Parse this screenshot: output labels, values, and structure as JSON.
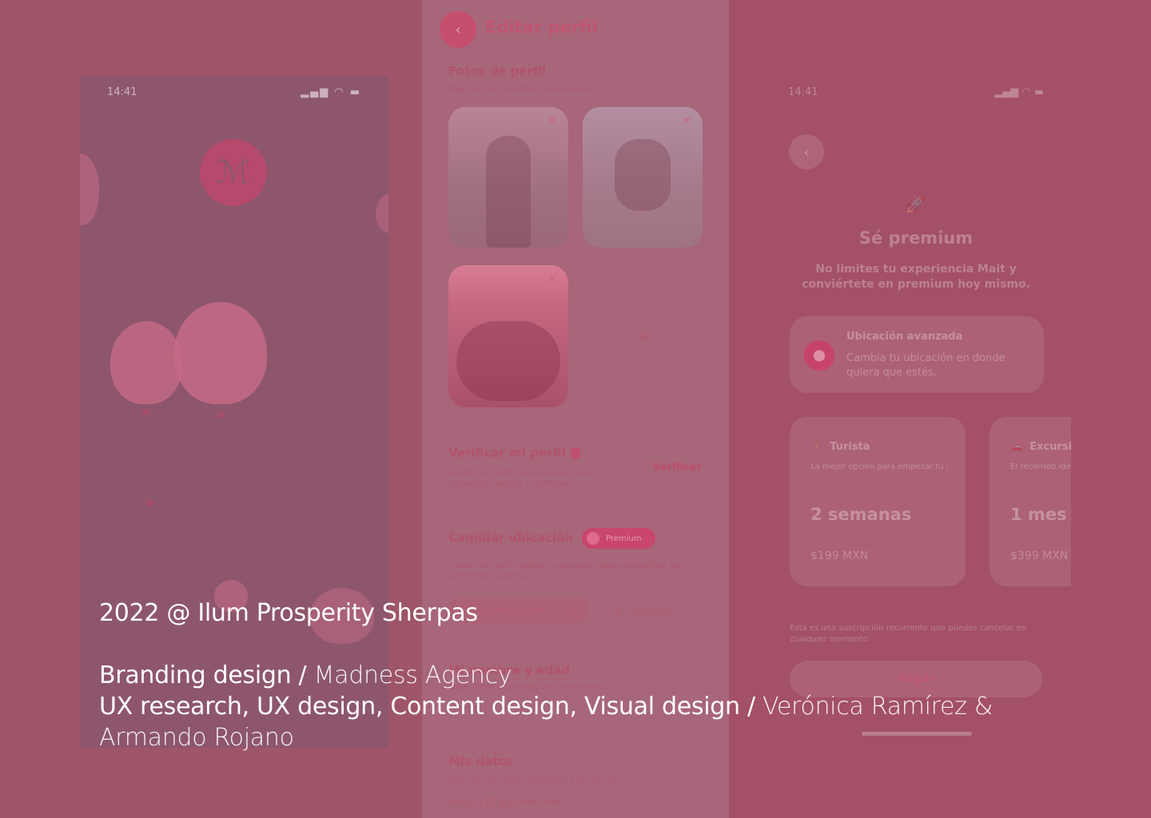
{
  "left_phone": {
    "time": "14:41",
    "status_icons": "▂▄▆ ◠ ▬"
  },
  "edit_profile": {
    "back_icon": "‹",
    "title": "Editar perfil",
    "photos_heading": "Fotos de perfil",
    "photos_sub": "Elige las que muestren tu verdadero yo.",
    "remove_icon": "✕",
    "add_photo_icon": "+",
    "verify_heading": "Verificar mi perfil",
    "verify_sub": "Verifica tu perfil para mantener una comunidad segura y confiable.",
    "verify_link": "Verificar",
    "location_heading": "Cambiar ubicación",
    "premium_badge": "Premium",
    "location_sub": "¿Sales de viaje? Cambia tu ubicación para utilizar Mait de diferentes maneras.",
    "location_chip": "Ubicación actual",
    "add_label": "Agregar",
    "name_heading": "Mi nombre y edad",
    "name_sub": "Estos datos no pueden ser cambiados.",
    "data_heading": "Mis datos",
    "data_sub": "Estos son los datos asociados a tu cuenta.",
    "email": "angel123@correo.mx"
  },
  "premium": {
    "time": "14:41",
    "status_icons": "▂▄▆ ◠ ▬",
    "back_icon": "‹",
    "rocket_icon": "🚀",
    "title": "Sé premium",
    "subtitle": "No limites tu experiencia Mait y conviértete en premium hoy mismo.",
    "feature_title": "Ubicación avanzada",
    "feature_desc": "Cambia tu ubicación en donde quiera que estés.",
    "feature_icon": "⬤",
    "plans": [
      {
        "icon": "🚶",
        "name": "Turista",
        "desc": "La mejor opción para empezar tu aventura.",
        "duration": "2 semanas",
        "price": "$199 MXN"
      },
      {
        "icon": "🚗",
        "name": "Excursionista",
        "desc": "El recorrido ideal para llegar lejos.",
        "duration": "1 mes",
        "price": "$399 MXN"
      }
    ],
    "note": "Esta es una suscripción recurrente que puedes cancelar en cualquier momento.",
    "pay_button": "Pagar"
  },
  "credits": {
    "year_line": "2022 @ Ilum Prosperity Sherpas",
    "lines": [
      {
        "role": "Branding design / ",
        "who": "Madness Agency"
      },
      {
        "role": "UX research, UX design, Content design, Visual design / ",
        "who": "Verónica Ramírez & Armando Rojano"
      }
    ]
  }
}
